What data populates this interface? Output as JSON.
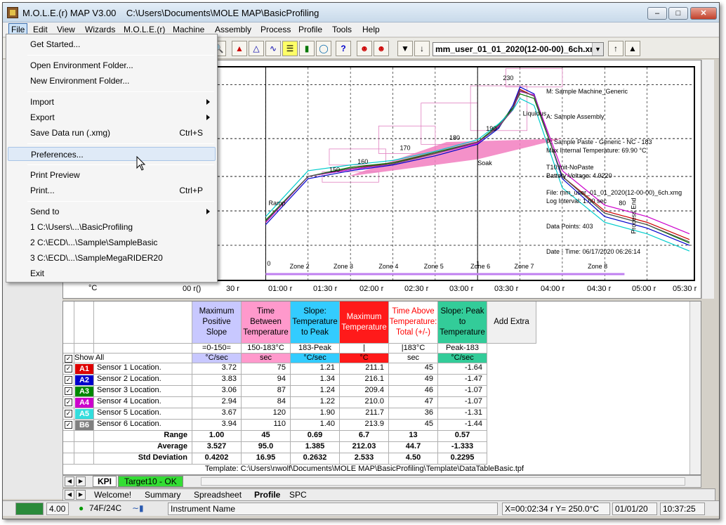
{
  "window": {
    "title": "M.O.L.E.(r) MAP V3.00    C:\\Users\\Documents\\MOLE MAP\\BasicProfiling"
  },
  "menubar": [
    "File",
    "Edit",
    "View",
    "Wizards",
    "M.O.L.E.(r)",
    "Machine",
    "Assembly",
    "Process",
    "Profile",
    "Tools",
    "Help"
  ],
  "file_menu": {
    "items": [
      {
        "label": "Get Started...",
        "shortcut": "",
        "submenu": false
      },
      {
        "label": "Open Environment Folder...",
        "shortcut": "",
        "submenu": false
      },
      {
        "label": "New Environment Folder...",
        "shortcut": "",
        "submenu": false
      },
      {
        "label": "Import",
        "shortcut": "",
        "submenu": true
      },
      {
        "label": "Export",
        "shortcut": "",
        "submenu": true
      },
      {
        "label": "Save Data run (.xmg)",
        "shortcut": "Ctrl+S",
        "submenu": false
      },
      {
        "label": "Preferences...",
        "shortcut": "",
        "submenu": false
      },
      {
        "label": "Print Preview",
        "shortcut": "",
        "submenu": false
      },
      {
        "label": "Print...",
        "shortcut": "Ctrl+P",
        "submenu": false
      },
      {
        "label": "Send to",
        "shortcut": "",
        "submenu": true
      },
      {
        "label": "1 C:\\Users\\...\\BasicProfiling",
        "shortcut": "",
        "submenu": false
      },
      {
        "label": "2 C:\\ECD\\...\\Sample\\SampleBasic",
        "shortcut": "",
        "submenu": false
      },
      {
        "label": "3 C:\\ECD\\...\\SampleMegaRIDER20",
        "shortcut": "",
        "submenu": false
      },
      {
        "label": "Exit",
        "shortcut": "",
        "submenu": false
      }
    ]
  },
  "toolbar": {
    "run_select": "mm_user_01_01_2020(12-00-00)_6ch.xr"
  },
  "chart": {
    "info": [
      "M: Sample Machine_Generic",
      "A: Sample Assembly",
      "P: Sample Paste - Generic - NC - 183",
      "T10:Init-NoPaste",
      "File: mm_user_01_01_2020(12-00-00)_6ch.xmg"
    ],
    "stats": [
      "Max Internal Temperature: 69.90 °C",
      "Battery Voltage: 4.9220",
      "Log Interval: 1.00 sec",
      "Data Points: 403",
      "Date - Time: 06/17/2020 06:26:14"
    ],
    "labels": {
      "l150": "150",
      "l160": "160",
      "l170": "170",
      "l180": "180",
      "l190": "190",
      "l230": "230",
      "l80": "80",
      "liquidus": "Liquidus",
      "soak": "Soak",
      "ramp": "Ramp",
      "process_end": "Process End",
      "unit": "°C",
      "zone_start": "0",
      "zone_mark": "1"
    },
    "zones": [
      "Zone 2",
      "Zone 3",
      "Zone 4",
      "Zone 5",
      "Zone 6",
      "Zone 7",
      "Zone 8"
    ],
    "xticks": [
      "00 r()",
      "30 r",
      "01:00 r",
      "01:30 r",
      "02:00 r",
      "02:30 r",
      "03:00 r",
      "03:30 r",
      "04:00 r",
      "04:30 r",
      "05:00 r",
      "05:30 r"
    ]
  },
  "chart_data": {
    "type": "line",
    "x_label": "",
    "series": [
      {
        "color": "#cc0000",
        "values": [
          [
            0,
            110
          ],
          [
            30,
            150
          ],
          [
            60,
            157
          ],
          [
            90,
            162
          ],
          [
            120,
            170
          ],
          [
            150,
            180
          ],
          [
            165,
            193
          ],
          [
            175,
            210
          ],
          [
            180,
            226
          ],
          [
            190,
            220
          ],
          [
            210,
            150
          ],
          [
            240,
            120
          ],
          [
            270,
            110
          ],
          [
            300,
            95
          ]
        ]
      },
      {
        "color": "#0000cc",
        "values": [
          [
            0,
            108
          ],
          [
            30,
            148
          ],
          [
            60,
            155
          ],
          [
            90,
            160
          ],
          [
            120,
            168
          ],
          [
            150,
            178
          ],
          [
            165,
            192
          ],
          [
            175,
            212
          ],
          [
            180,
            228
          ],
          [
            190,
            222
          ],
          [
            210,
            148
          ],
          [
            240,
            115
          ],
          [
            270,
            105
          ],
          [
            300,
            90
          ]
        ]
      },
      {
        "color": "#007700",
        "values": [
          [
            0,
            112
          ],
          [
            30,
            150
          ],
          [
            60,
            158
          ],
          [
            90,
            162
          ],
          [
            120,
            171
          ],
          [
            150,
            180
          ],
          [
            165,
            195
          ],
          [
            175,
            210
          ],
          [
            180,
            222
          ],
          [
            190,
            218
          ],
          [
            210,
            150
          ],
          [
            240,
            118
          ],
          [
            270,
            108
          ],
          [
            300,
            92
          ]
        ]
      },
      {
        "color": "#cc00cc",
        "values": [
          [
            0,
            110
          ],
          [
            30,
            150
          ],
          [
            60,
            156
          ],
          [
            90,
            161
          ],
          [
            120,
            170
          ],
          [
            150,
            179
          ],
          [
            165,
            194
          ],
          [
            175,
            208
          ],
          [
            180,
            224
          ],
          [
            190,
            221
          ],
          [
            210,
            155
          ],
          [
            240,
            125
          ],
          [
            270,
            115
          ],
          [
            300,
            100
          ]
        ]
      },
      {
        "color": "#00cccc",
        "values": [
          [
            0,
            115
          ],
          [
            30,
            155
          ],
          [
            60,
            160
          ],
          [
            90,
            164
          ],
          [
            120,
            172
          ],
          [
            150,
            182
          ],
          [
            165,
            196
          ],
          [
            175,
            208
          ],
          [
            180,
            218
          ],
          [
            190,
            212
          ],
          [
            210,
            140
          ],
          [
            240,
            110
          ],
          [
            270,
            100
          ],
          [
            300,
            85
          ]
        ]
      },
      {
        "color": "#555555",
        "values": [
          [
            0,
            111
          ],
          [
            30,
            150
          ],
          [
            60,
            157
          ],
          [
            90,
            161
          ],
          [
            120,
            170
          ],
          [
            150,
            180
          ],
          [
            165,
            193
          ],
          [
            175,
            209
          ],
          [
            180,
            225
          ],
          [
            190,
            220
          ],
          [
            210,
            150
          ],
          [
            240,
            118
          ],
          [
            270,
            108
          ],
          [
            300,
            93
          ]
        ]
      }
    ]
  },
  "table": {
    "headers": [
      {
        "label": "Maximum Positive Slope",
        "color": "#c8c8ff",
        "text": "#000"
      },
      {
        "label": "Time Between Temperature",
        "color": "#ff99cc",
        "text": "#000"
      },
      {
        "label": "Slope: Temperature to Peak",
        "color": "#33ccff",
        "text": "#000"
      },
      {
        "label": "Maximum Temperature",
        "color": "#ff1a1a",
        "text": "#fff"
      },
      {
        "label": "Time Above Temperature: Total (+/-)",
        "color": "#ffffff",
        "text": "#ff0000"
      },
      {
        "label": "Slope: Peak to Temperature",
        "color": "#33cc99",
        "text": "#000"
      }
    ],
    "add_extra": "Add Extra",
    "params": [
      "=0-150=",
      "150-183°C",
      "183-Peak",
      "|",
      "|183°C",
      "Peak-183"
    ],
    "units": [
      "°C/sec",
      "sec",
      "°C/sec",
      "°C",
      "sec",
      "°C/sec"
    ],
    "unit_colors": [
      "#c8c8ff",
      "#ff99cc",
      "#33ccff",
      "#ff1a1a",
      "#ffffff",
      "#33cc99"
    ],
    "show_all": "Show All",
    "rows": [
      {
        "badge": "A1",
        "color": "#dd0000",
        "name": "Sensor 1 Location.",
        "values": [
          "3.72",
          "75",
          "1.21",
          "211.1",
          "45",
          "-1.64"
        ]
      },
      {
        "badge": "A2",
        "color": "#0000cc",
        "name": "Sensor 2 Location.",
        "values": [
          "3.83",
          "94",
          "1.34",
          "216.1",
          "49",
          "-1.47"
        ]
      },
      {
        "badge": "A3",
        "color": "#008800",
        "name": "Sensor 3 Location.",
        "values": [
          "3.06",
          "87",
          "1.24",
          "209.4",
          "46",
          "-1.07"
        ]
      },
      {
        "badge": "A4",
        "color": "#cc00cc",
        "name": "Sensor 4 Location.",
        "values": [
          "2.94",
          "84",
          "1.22",
          "210.0",
          "47",
          "-1.07"
        ]
      },
      {
        "badge": "A5",
        "color": "#33dddd",
        "name": "Sensor 5 Location.",
        "values": [
          "3.67",
          "120",
          "1.90",
          "211.7",
          "36",
          "-1.31"
        ]
      },
      {
        "badge": "B6",
        "color": "#808080",
        "name": "Sensor 6 Location.",
        "values": [
          "3.94",
          "110",
          "1.40",
          "213.9",
          "45",
          "-1.44"
        ]
      }
    ],
    "summary": [
      {
        "label": "Range",
        "values": [
          "1.00",
          "45",
          "0.69",
          "6.7",
          "13",
          "0.57"
        ]
      },
      {
        "label": "Average",
        "values": [
          "3.527",
          "95.0",
          "1.385",
          "212.03",
          "44.7",
          "-1.333"
        ]
      },
      {
        "label": "Std Deviation",
        "values": [
          "0.4202",
          "16.95",
          "0.2632",
          "2.533",
          "4.50",
          "0.2295"
        ]
      }
    ],
    "template": "Template: C:\\Users\\nwolf\\Documents\\MOLE MAP\\BasicProfiling\\Template\\DataTableBasic.tpf"
  },
  "tabs_top": [
    "KPI",
    "Target10 - OK"
  ],
  "tabs_bottom": [
    "Welcome!",
    "Summary",
    "Spreadsheet",
    "Profile",
    "SPC"
  ],
  "status": {
    "voltage": "4.00",
    "temp": "74F/24C",
    "instrument": "Instrument Name",
    "coords": "X=00:02:34 r Y= 250.0°C",
    "date": "01/01/20",
    "time": "10:37:25"
  }
}
